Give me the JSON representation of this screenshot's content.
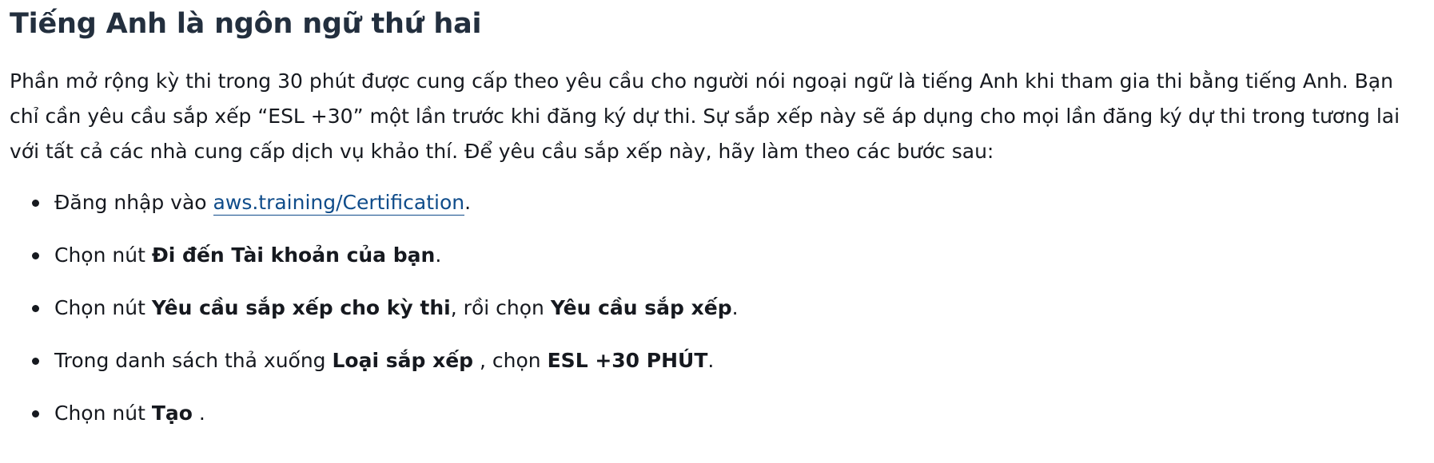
{
  "section": {
    "title": "Tiếng Anh là ngôn ngữ thứ hai",
    "intro": "Phần mở rộng kỳ thi trong 30 phút được cung cấp theo yêu cầu cho người nói ngoại ngữ là tiếng Anh khi tham gia thi bằng tiếng Anh. Bạn chỉ cần yêu cầu sắp xếp “ESL +30” một lần trước khi đăng ký dự thi. Sự sắp xếp này sẽ áp dụng cho mọi lần đăng ký dự thi trong tương lai với tất cả các nhà cung cấp dịch vụ khảo thí. Để yêu cầu sắp xếp này, hãy làm theo các bước sau:"
  },
  "steps": {
    "step1": {
      "text_before": "Đăng nhập vào ",
      "link_text": "aws.training/Certification",
      "text_after": "."
    },
    "step2": {
      "text_before": "Chọn nút ",
      "bold1": "Đi đến Tài khoản của bạn",
      "text_after": "."
    },
    "step3": {
      "text_before": "Chọn nút ",
      "bold1": "Yêu cầu sắp xếp cho kỳ thi",
      "text_mid": ", rồi chọn ",
      "bold2": "Yêu cầu sắp xếp",
      "text_after": "."
    },
    "step4": {
      "text_before": "Trong danh sách thả xuống ",
      "bold1": "Loại sắp xếp",
      "text_mid": " , chọn ",
      "bold2": "ESL +30 PHÚT",
      "text_after": "."
    },
    "step5": {
      "text_before": "Chọn nút ",
      "bold1": "Tạo",
      "text_after": " ."
    }
  },
  "colors": {
    "heading": "#232f3e",
    "text": "#16191f",
    "link": "#0f4c8a"
  }
}
